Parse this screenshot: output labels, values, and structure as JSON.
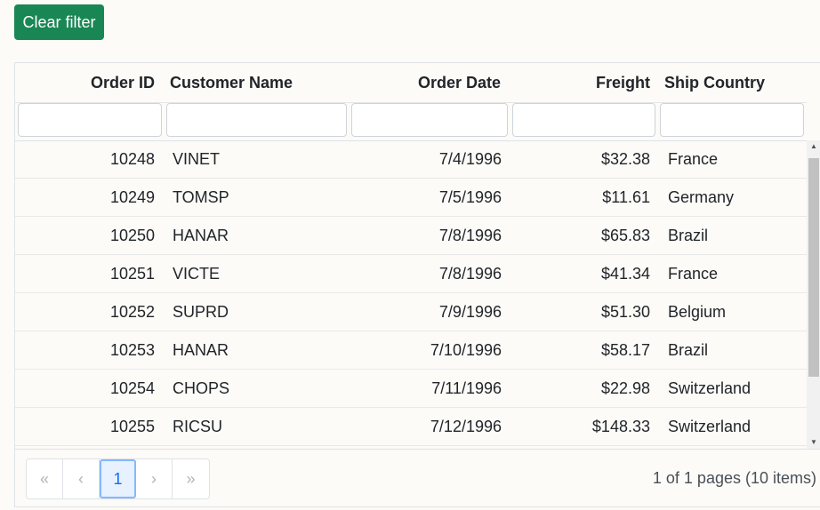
{
  "toolbar": {
    "clear_filter_label": "Clear filter"
  },
  "columns": {
    "order_id": "Order ID",
    "customer_name": "Customer Name",
    "order_date": "Order Date",
    "freight": "Freight",
    "ship_country": "Ship Country"
  },
  "filters": {
    "order_id": "",
    "customer_name": "",
    "order_date": "",
    "freight": "",
    "ship_country": ""
  },
  "rows": [
    {
      "order_id": "10248",
      "customer_name": "VINET",
      "order_date": "7/4/1996",
      "freight": "$32.38",
      "ship_country": "France"
    },
    {
      "order_id": "10249",
      "customer_name": "TOMSP",
      "order_date": "7/5/1996",
      "freight": "$11.61",
      "ship_country": "Germany"
    },
    {
      "order_id": "10250",
      "customer_name": "HANAR",
      "order_date": "7/8/1996",
      "freight": "$65.83",
      "ship_country": "Brazil"
    },
    {
      "order_id": "10251",
      "customer_name": "VICTE",
      "order_date": "7/8/1996",
      "freight": "$41.34",
      "ship_country": "France"
    },
    {
      "order_id": "10252",
      "customer_name": "SUPRD",
      "order_date": "7/9/1996",
      "freight": "$51.30",
      "ship_country": "Belgium"
    },
    {
      "order_id": "10253",
      "customer_name": "HANAR",
      "order_date": "7/10/1996",
      "freight": "$58.17",
      "ship_country": "Brazil"
    },
    {
      "order_id": "10254",
      "customer_name": "CHOPS",
      "order_date": "7/11/1996",
      "freight": "$22.98",
      "ship_country": "Switzerland"
    },
    {
      "order_id": "10255",
      "customer_name": "RICSU",
      "order_date": "7/12/1996",
      "freight": "$148.33",
      "ship_country": "Switzerland"
    }
  ],
  "pager": {
    "first_label": "«",
    "prev_label": "‹",
    "current_page": "1",
    "next_label": "›",
    "last_label": "»",
    "info": "1 of 1 pages (10 items)"
  },
  "icons": {
    "scroll_up": "chevron-up-icon",
    "scroll_down": "chevron-down-icon"
  },
  "colors": {
    "accent": "#198754",
    "page_background": "#fcfbf8",
    "active_page": "#0d6efd"
  }
}
